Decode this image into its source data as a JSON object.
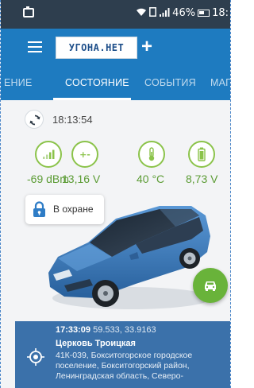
{
  "status_bar": {
    "battery_percent": "46%",
    "clock": "18:"
  },
  "app_bar": {
    "logo_text": "УГОНА.НЕТ",
    "add_label": "+"
  },
  "tabs": [
    {
      "label": "ЕНИЕ"
    },
    {
      "label": "СОСТОЯНИЕ"
    },
    {
      "label": "СОБЫТИЯ"
    },
    {
      "label": "МАГ"
    }
  ],
  "active_tab": "СОСТОЯНИЕ",
  "status": {
    "time": "18:13:54"
  },
  "gauges": [
    {
      "icon": "signal-icon",
      "value": "-69 dBm"
    },
    {
      "icon": "voltage-icon",
      "value": "13,16 V"
    },
    {
      "icon": "thermometer-icon",
      "value": "40 °C"
    },
    {
      "icon": "battery-icon",
      "value": "8,73 V"
    }
  ],
  "security": {
    "label": "В охране"
  },
  "location": {
    "time": "17:33:09",
    "coords": "59.533, 33.9163",
    "name": "Церковь Троицкая",
    "address": "41К-039, Бокситогорское городское поселение, Бокситогорский район, Ленинградская область, Северо-"
  },
  "colors": {
    "primary": "#1e7bc0",
    "accent_green": "#69b33a",
    "gauge_text": "#5c9c35",
    "location_bg": "#3b71aa",
    "car_body": "#3f7ec4"
  }
}
